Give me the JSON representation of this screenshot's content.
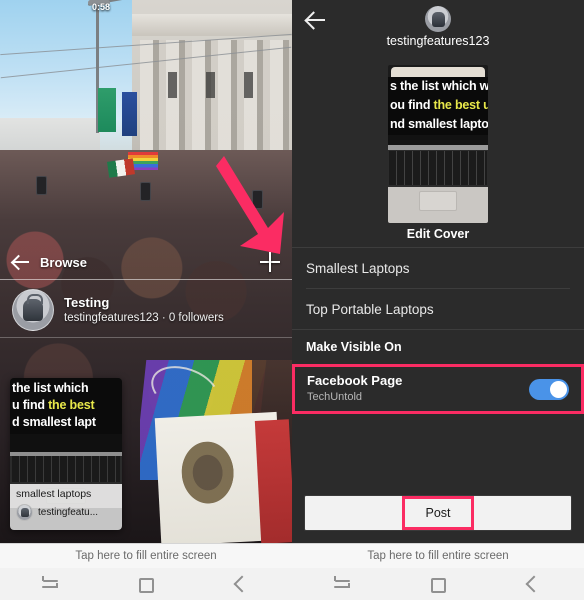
{
  "left_pane": {
    "browse_back_icon": "back-arrow-icon",
    "browse_label": "Browse",
    "plus_icon": "plus-icon",
    "channel": {
      "avatar_icon": "channel-avatar",
      "title": "Testing",
      "subtitle": "testingfeatures123  ·  0 followers"
    },
    "video_card": {
      "overlay_line1": "the list which",
      "overlay_line2_a": "u find ",
      "overlay_line2_b": "the best",
      "overlay_line3": "d smallest lapt",
      "duration": "0:58",
      "title": "smallest laptops",
      "author": "testingfeatu...",
      "author_avatar_icon": "author-avatar"
    },
    "annotation": {
      "arrow_icon": "pink-arrow-annotation",
      "color": "#fb2c63"
    }
  },
  "right_pane": {
    "back_icon": "back-arrow-icon",
    "avatar_icon": "profile-avatar",
    "username": "testingfeatures123",
    "cover": {
      "overlay_line1": "s the list which w",
      "overlay_line2_a": "ou find ",
      "overlay_line2_b": "the best u",
      "overlay_line3": "nd smallest lapto",
      "edit_label": "Edit Cover"
    },
    "rows": [
      {
        "label": "Smallest Laptops"
      },
      {
        "label": "Top Portable Laptops"
      }
    ],
    "section_header": "Make Visible On",
    "facebook": {
      "title": "Facebook Page",
      "subtitle": "TechUntold",
      "toggle_state": "on",
      "toggle_color": "#4a93e8",
      "highlight_color": "#fb2c63"
    },
    "post_button": {
      "label": "Post",
      "highlight_color": "#fb2c63"
    }
  },
  "system": {
    "tap_hint_left": "Tap here to fill entire screen",
    "tap_hint_right": "Tap here to fill entire screen",
    "nav_icons": [
      "recents-icon",
      "home-icon",
      "back-icon"
    ]
  }
}
